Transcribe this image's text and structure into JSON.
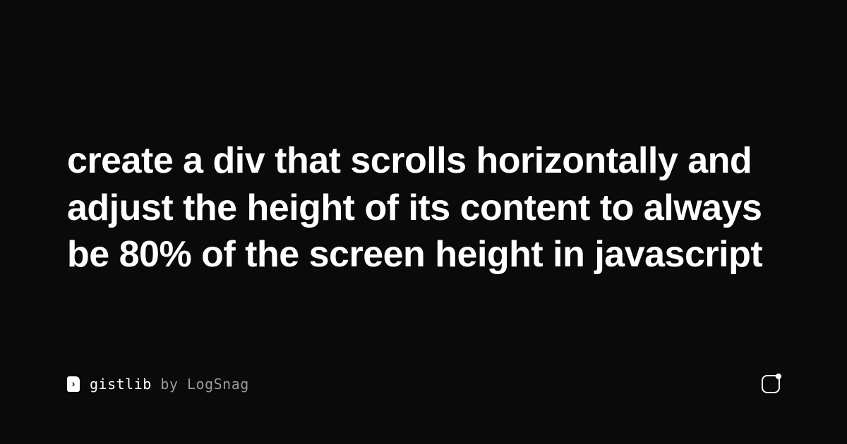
{
  "title": "create a div that scrolls horizontally and adjust the height of its content to always be 80% of the screen height in javascript",
  "brand": {
    "name": "gistlib",
    "by_label": "by",
    "author": "LogSnag"
  }
}
